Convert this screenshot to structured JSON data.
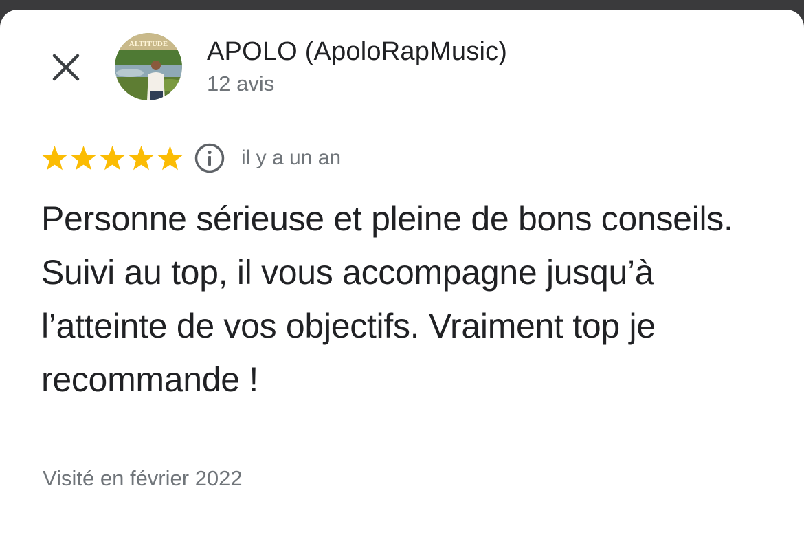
{
  "colors": {
    "star": "#fbbc04",
    "primary_text": "#202124",
    "secondary_text": "#70757a",
    "icon": "#3c4043",
    "background": "#ffffff"
  },
  "header": {
    "close_icon": "close-icon",
    "avatar_icon": "user-avatar-photo",
    "avatar_text": "ALTITUDE",
    "author_name": "APOLO (ApoloRapMusic)",
    "review_count": "12 avis"
  },
  "review": {
    "rating": 5,
    "rating_max": 5,
    "info_icon": "info-icon",
    "time_ago": "il y a un an",
    "text": "Personne sérieuse et pleine de bons conseils. Suivi au top, il vous accompagne jusqu’à l’atteinte de vos objectifs. Vraiment top je recommande !",
    "visit_date": "Visité en février 2022"
  }
}
